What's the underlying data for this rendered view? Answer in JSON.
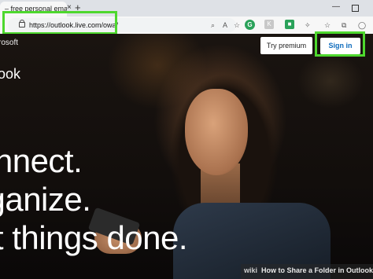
{
  "browser": {
    "tab_title": "– free personal email ar",
    "tab_close": "×",
    "new_tab": "+",
    "window_min": "—",
    "url": "https://outlook.live.com/owa/",
    "toolbar_icons": [
      "zoom-icon",
      "read-aloud-icon",
      "star-icon",
      "grammarly-icon",
      "extension-icon",
      "extension-green-icon",
      "puzzle-icon",
      "favorites-icon",
      "collections-icon",
      "profile-icon",
      "more-icon"
    ]
  },
  "page": {
    "brand": "rosoft",
    "product": "ook",
    "try_premium": "Try premium",
    "sign_in": "Sign in",
    "headline": [
      "onnect.",
      "rganize.",
      "et things done."
    ]
  },
  "watermark": {
    "logo": "wiki",
    "text": "How to Share a Folder in Outlook"
  },
  "colors": {
    "highlight": "#4ed82e",
    "signin_text": "#0f6cbd"
  }
}
